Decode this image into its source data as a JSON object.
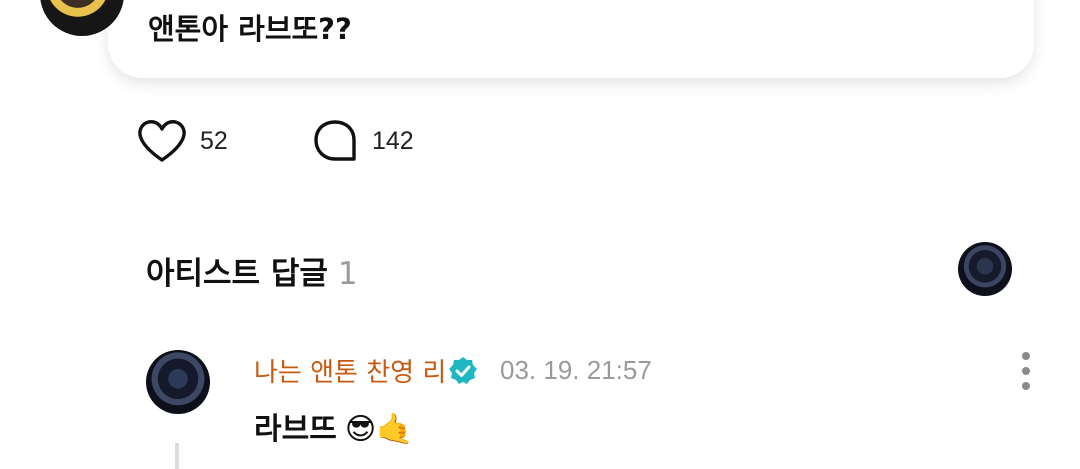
{
  "post": {
    "text": "앤톤아 라브또??"
  },
  "reactions": {
    "like_count": "52",
    "comment_count": "142"
  },
  "artist_replies": {
    "title": "아티스트 답글",
    "count": "1"
  },
  "reply": {
    "author": "나는 앤톤 찬영 리",
    "timestamp": "03. 19. 21:57",
    "text": "라브뜨",
    "emojis": "😎🤙"
  },
  "icons": {
    "like": "heart-icon",
    "comment": "speech-bubble-icon",
    "verified": "verified-badge-icon",
    "more": "more-vertical-icon"
  },
  "colors": {
    "author_name": "#c75a12",
    "verified_badge": "#1fb7c4",
    "muted_text": "#9a9a9a"
  }
}
